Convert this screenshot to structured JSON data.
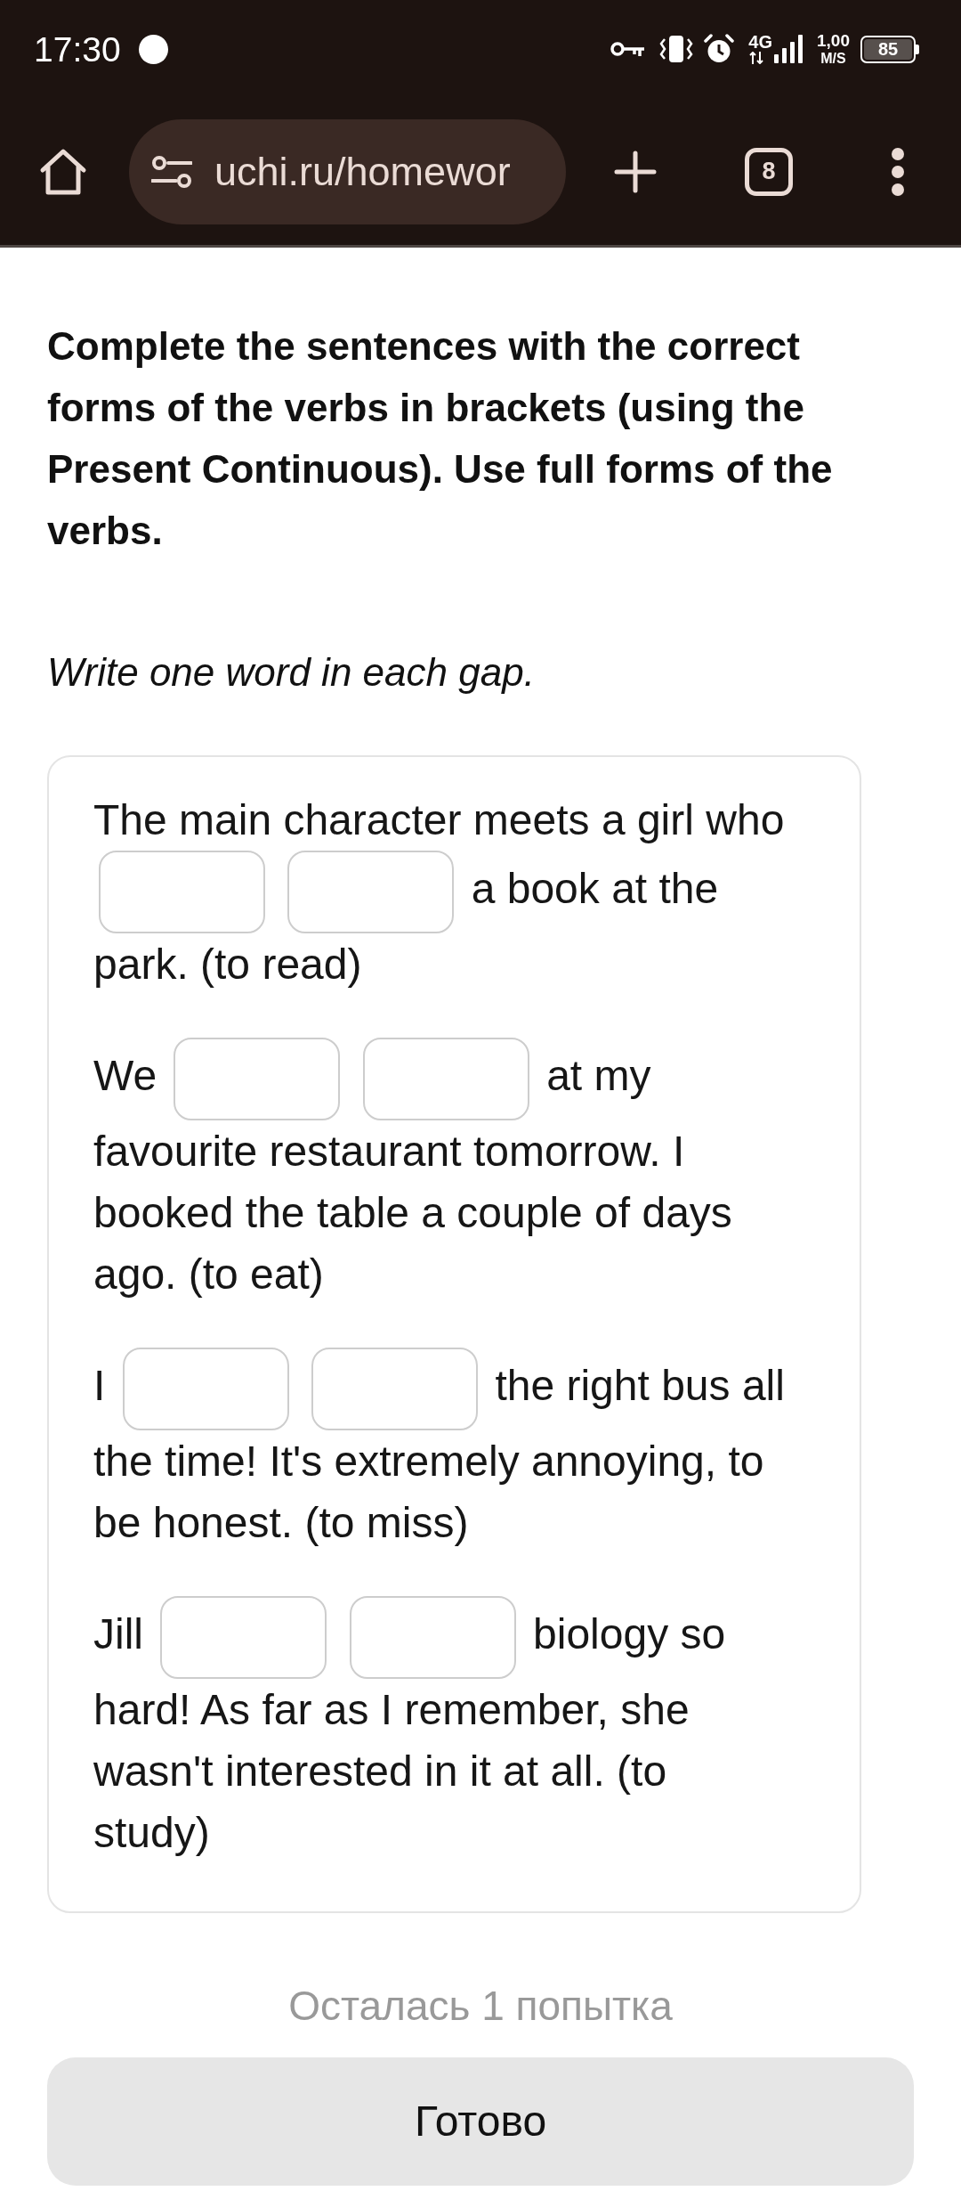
{
  "status_bar": {
    "time": "17:30",
    "network": "4G",
    "speed": "1,00",
    "speed_unit": "M/S",
    "battery": "85"
  },
  "browser": {
    "url": "uchi.ru/homewor",
    "tab_count": "8"
  },
  "task": {
    "instruction": "Complete the sentences with the correct forms of the verbs in brackets (using the Present Continuous). Use full forms of the verbs.",
    "hint": "Write one word in each gap.",
    "sentences": [
      {
        "parts": [
          {
            "kind": "text",
            "text": "The main character meets a girl who"
          },
          {
            "kind": "gap"
          },
          {
            "kind": "gap"
          },
          {
            "kind": "text",
            "text": "a book at the park. (to read)"
          }
        ]
      },
      {
        "parts": [
          {
            "kind": "text",
            "text": "We"
          },
          {
            "kind": "gap"
          },
          {
            "kind": "gap"
          },
          {
            "kind": "text",
            "text": "at my favourite restaurant tomorrow. I booked the table a couple of days ago. (to eat)"
          }
        ]
      },
      {
        "parts": [
          {
            "kind": "text",
            "text": "I"
          },
          {
            "kind": "gap"
          },
          {
            "kind": "gap"
          },
          {
            "kind": "text",
            "text": "the right bus all the time! It's extremely annoying, to be honest. (to miss)"
          }
        ]
      },
      {
        "parts": [
          {
            "kind": "text",
            "text": "Jill"
          },
          {
            "kind": "gap"
          },
          {
            "kind": "gap"
          },
          {
            "kind": "text",
            "text": "biology so hard! As far as I remember, she wasn't interested in it at all. (to study)"
          }
        ]
      }
    ]
  },
  "attempts_left": "Осталась 1 попытка",
  "submit_button": "Готово"
}
